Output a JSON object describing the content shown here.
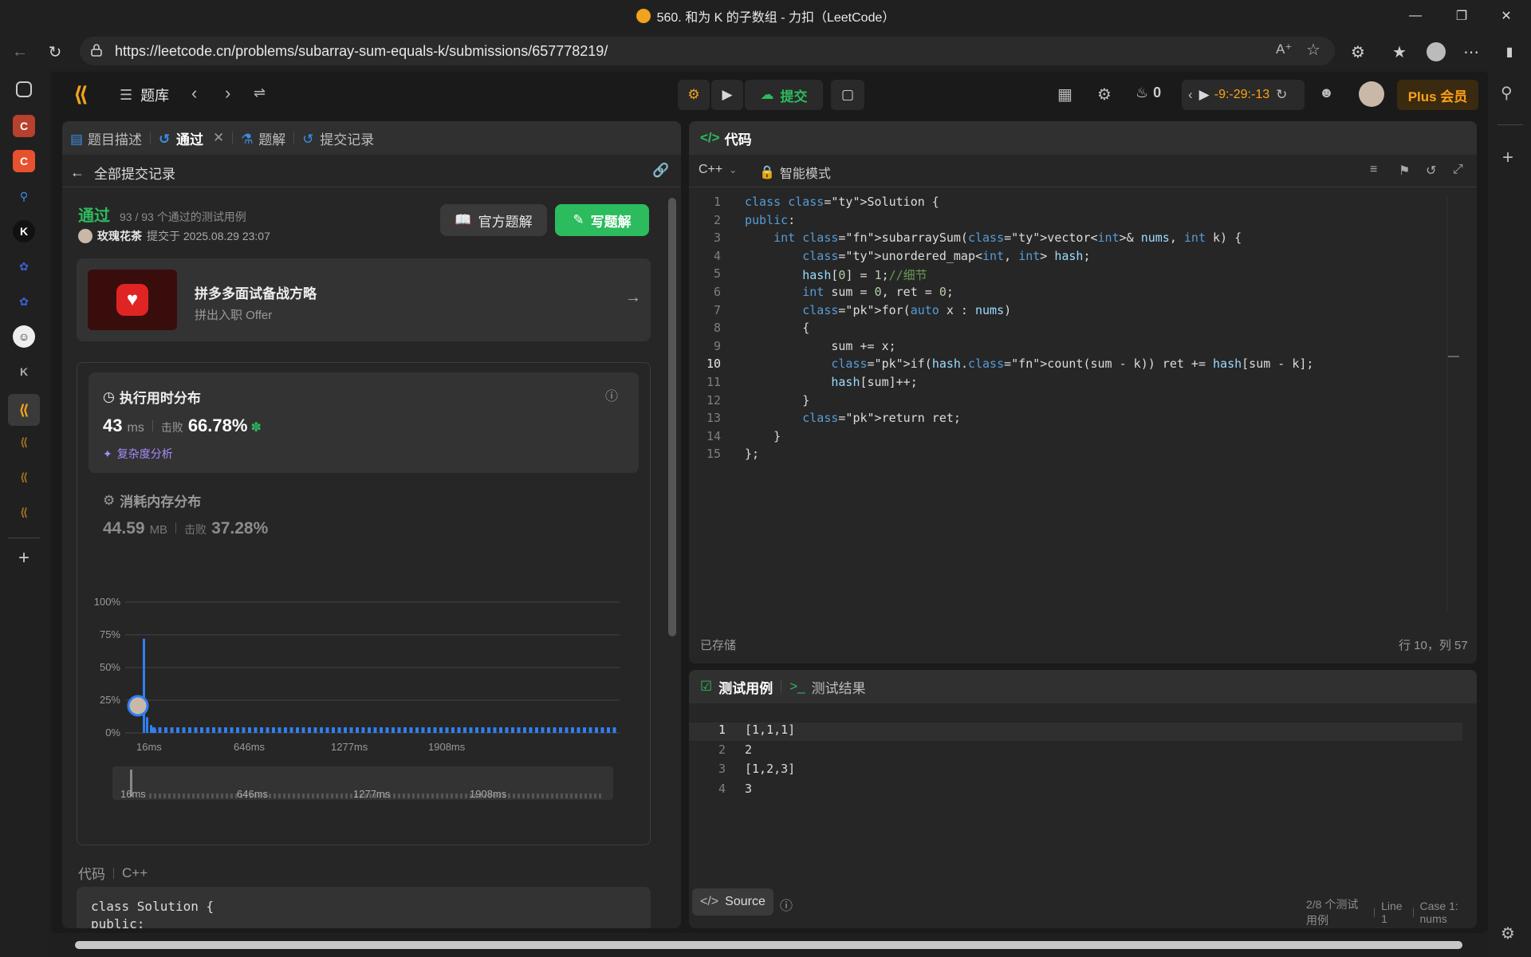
{
  "browser": {
    "title": "560. 和为 K 的子数组 - 力扣（LeetCode）",
    "url": "https://leetcode.cn/problems/subarray-sum-equals-k/submissions/657778219/"
  },
  "nav": {
    "problem_bank": "题库",
    "submit": "提交",
    "streak_count": "0",
    "timer": "-9:-29:-13",
    "plus": "Plus 会员"
  },
  "left_tabs": [
    {
      "label": "题目描述"
    },
    {
      "label": "通过"
    },
    {
      "label": "题解"
    },
    {
      "label": "提交记录"
    }
  ],
  "submission": {
    "back_label": "全部提交记录",
    "status": "通过",
    "tests_passed": "93 / 93 个通过的测试用例",
    "user": "玫瑰花茶",
    "submitted_at": "提交于 2025.08.29 23:07",
    "official_solution": "官方题解",
    "write_solution": "写题解"
  },
  "promo": {
    "title": "拼多多面试备战方略",
    "subtitle": "拼出入职 Offer"
  },
  "runtime": {
    "title": "执行用时分布",
    "value": "43",
    "unit": "ms",
    "beats_label": "击败",
    "beats": "66.78%",
    "complexity": "复杂度分析"
  },
  "memory": {
    "title": "消耗内存分布",
    "value": "44.59",
    "unit": "MB",
    "beats_label": "击败",
    "beats": "37.28%"
  },
  "chart_data": {
    "type": "bar",
    "y_ticks": [
      "100%",
      "75%",
      "50%",
      "25%",
      "0%"
    ],
    "x_ticks": [
      "16ms",
      "646ms",
      "1277ms",
      "1908ms"
    ],
    "ylim": [
      0,
      100
    ],
    "highlight_value": 72,
    "secondary_values": [
      12,
      6,
      3
    ]
  },
  "code_section": {
    "label": "代码",
    "lang": "C++",
    "preview_line1": "class Solution {",
    "preview_line2": "public:"
  },
  "editor": {
    "tab_label": "代码",
    "language": "C++",
    "mode": "智能模式",
    "saved": "已存储",
    "cursor": "行 10，列 57",
    "lines": [
      "class Solution {",
      "public:",
      "    int subarraySum(vector<int>& nums, int k) {",
      "        unordered_map<int, int> hash;",
      "        hash[0] = 1;//细节",
      "        int sum = 0, ret = 0;",
      "        for(auto x : nums)",
      "        {",
      "            sum += x;",
      "            if(hash.count(sum - k)) ret += hash[sum - k];",
      "            hash[sum]++;",
      "        }",
      "        return ret;",
      "    }",
      "};"
    ]
  },
  "testcase": {
    "tab1": "测试用例",
    "tab2": "测试结果",
    "lines": [
      "[1,1,1]",
      "2",
      "[1,2,3]",
      "3"
    ],
    "source": "Source",
    "footer_cases": "2/8 个测试用例",
    "footer_line": "Line 1",
    "footer_case": "Case 1: nums"
  },
  "colors": {
    "accent_green": "#2cbb5d",
    "bar_blue": "#2f7ff0",
    "plus_orange": "#ffa116"
  }
}
